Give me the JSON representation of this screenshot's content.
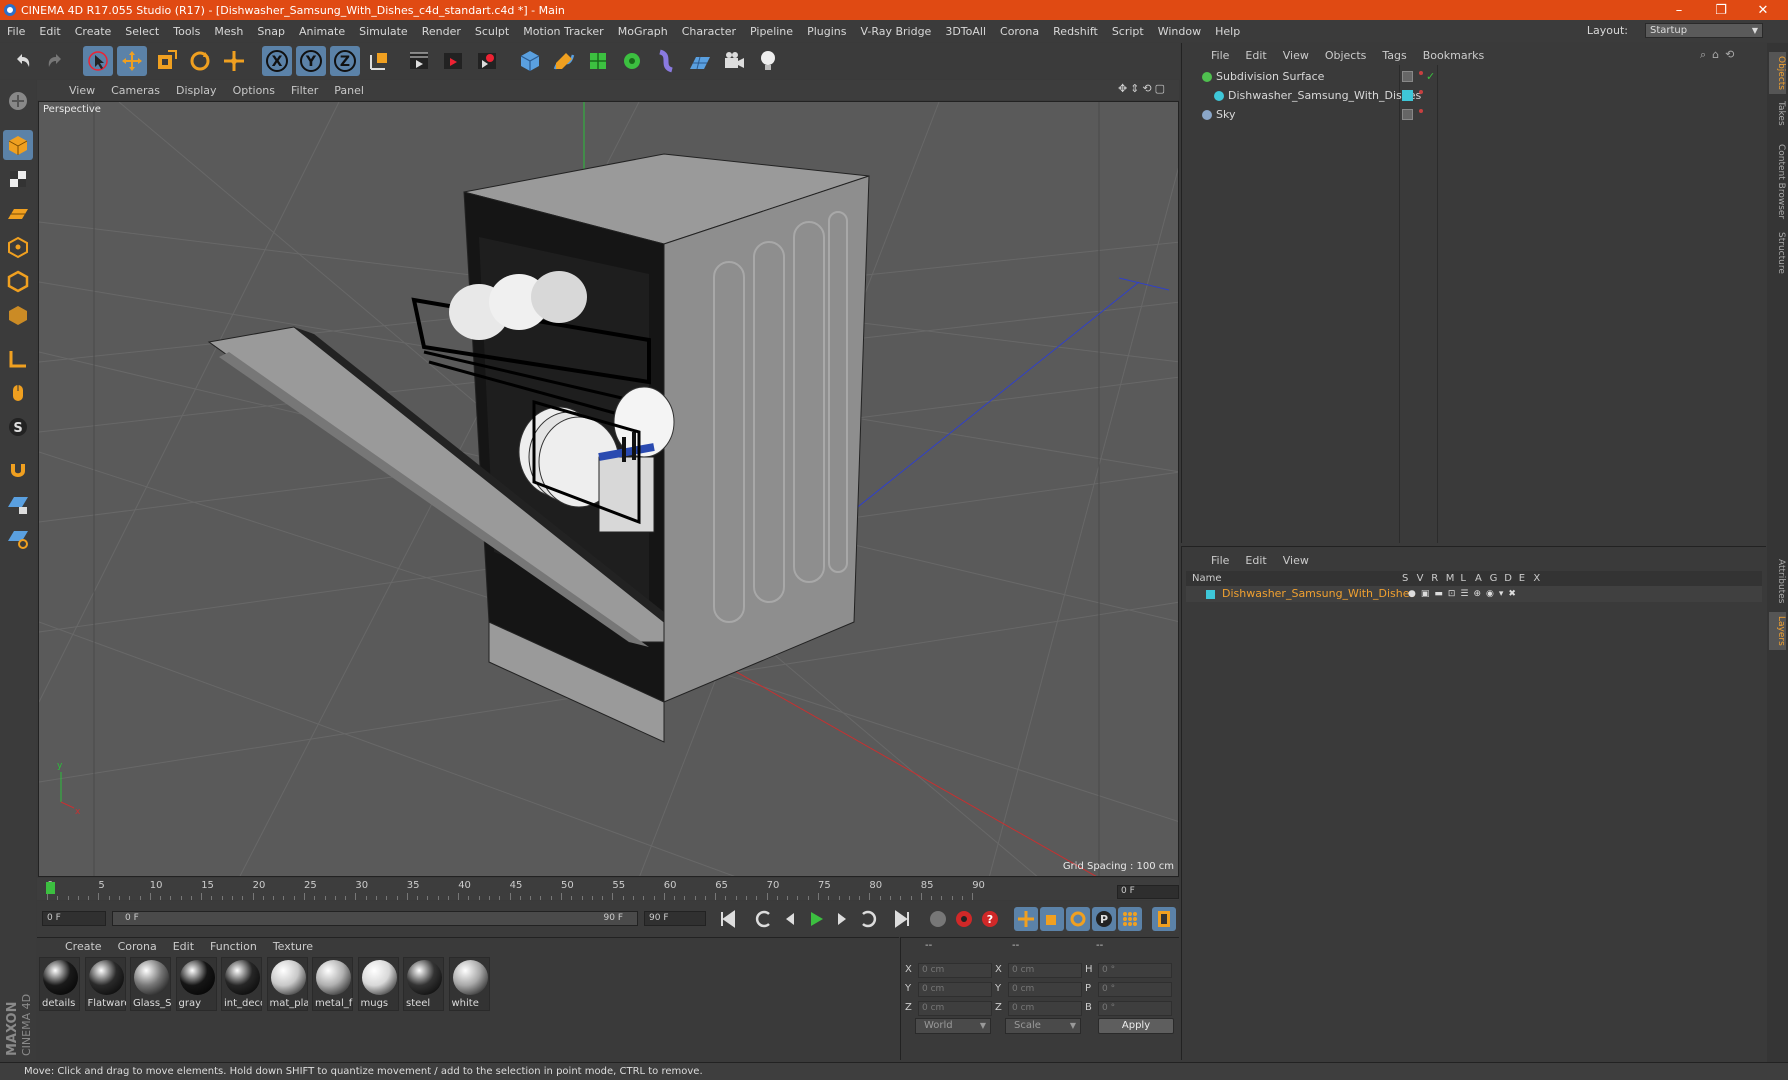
{
  "window": {
    "title": "CINEMA 4D R17.055 Studio (R17) - [Dishwasher_Samsung_With_Dishes_c4d_standart.c4d *] - Main",
    "controls": [
      "–",
      "❐",
      "✕"
    ]
  },
  "menubar": [
    "File",
    "Edit",
    "Create",
    "Select",
    "Tools",
    "Mesh",
    "Snap",
    "Animate",
    "Simulate",
    "Render",
    "Sculpt",
    "Motion Tracker",
    "MoGraph",
    "Character",
    "Pipeline",
    "Plugins",
    "V-Ray Bridge",
    "3DToAll",
    "Corona",
    "Redshift",
    "Script",
    "Window",
    "Help"
  ],
  "layout": {
    "label": "Layout:",
    "value": "Startup"
  },
  "toolbar": {
    "icons": [
      "undo-icon",
      "redo-icon",
      "select-icon",
      "move-icon",
      "scale-icon",
      "rotate-icon",
      "transform-icon",
      "x-axis-icon",
      "y-axis-icon",
      "z-axis-icon",
      "coordinate-icon",
      "render-view-icon",
      "render-picture-viewer-icon",
      "render-settings-icon",
      "cube-icon",
      "pen-icon",
      "subdivision-icon",
      "array-icon",
      "deformer-icon",
      "floor-icon",
      "camera-icon",
      "light-icon"
    ],
    "axis_labels": [
      "X",
      "Y",
      "Z"
    ]
  },
  "viewport": {
    "menu": [
      "View",
      "Cameras",
      "Display",
      "Options",
      "Filter",
      "Panel"
    ],
    "label": "Perspective",
    "grid_spacing": "Grid Spacing : 100 cm"
  },
  "timeline": {
    "ticks": [
      "0",
      "5",
      "10",
      "15",
      "20",
      "25",
      "30",
      "35",
      "40",
      "45",
      "50",
      "55",
      "60",
      "65",
      "70",
      "75",
      "80",
      "85",
      "90"
    ],
    "current_frame": "0 F",
    "start": "0 F",
    "range_start": "0 F",
    "range_end": "90 F",
    "end": "90 F"
  },
  "materials": {
    "menu": [
      "Create",
      "Corona",
      "Edit",
      "Function",
      "Texture"
    ],
    "items": [
      {
        "label": "details",
        "color": "#1a1a1a"
      },
      {
        "label": "Flatware",
        "color": "#2a2a2a"
      },
      {
        "label": "Glass_Si",
        "color": "#777777"
      },
      {
        "label": "gray",
        "color": "#151515"
      },
      {
        "label": "int_deco",
        "color": "#262626"
      },
      {
        "label": "mat_pla",
        "color": "#c8c8c8"
      },
      {
        "label": "metal_fr",
        "color": "#b0b0b0"
      },
      {
        "label": "mugs",
        "color": "#d8d8d8"
      },
      {
        "label": "steel",
        "color": "#333333"
      },
      {
        "label": "white",
        "color": "#a8a8a8"
      }
    ]
  },
  "coordinates": {
    "headers": [
      "--",
      "--",
      "--"
    ],
    "rows": [
      {
        "a": "X",
        "av": "0 cm",
        "b": "X",
        "bv": "0 cm",
        "c": "H",
        "cv": "0 °"
      },
      {
        "a": "Y",
        "av": "0 cm",
        "b": "Y",
        "bv": "0 cm",
        "c": "P",
        "cv": "0 °"
      },
      {
        "a": "Z",
        "av": "0 cm",
        "b": "Z",
        "bv": "0 cm",
        "c": "B",
        "cv": "0 °"
      }
    ],
    "space": "World",
    "mode": "Scale",
    "apply": "Apply"
  },
  "objects": {
    "menu": [
      "File",
      "Edit",
      "View",
      "Objects",
      "Tags",
      "Bookmarks"
    ],
    "items": [
      {
        "name": "Subdivision Surface",
        "indent": 0,
        "color": "#4fc04f"
      },
      {
        "name": "Dishwasher_Samsung_With_Dishes",
        "indent": 1,
        "color": "#3ec7d8"
      },
      {
        "name": "Sky",
        "indent": 0,
        "color": "#8aa6c8"
      }
    ]
  },
  "layers": {
    "menu": [
      "File",
      "Edit",
      "View"
    ],
    "columns": [
      "Name",
      "S",
      "V",
      "R",
      "M",
      "L",
      "A",
      "G",
      "D",
      "E",
      "X"
    ],
    "row": {
      "name": "Dishwasher_Samsung_With_Dishes",
      "color": "#f0a030",
      "swatch": "#3ec7d8"
    }
  },
  "right_tabs": [
    "Objects",
    "Takes",
    "Content Browser",
    "Structure",
    "Attributes",
    "Layers"
  ],
  "statusbar": "Move: Click and drag to move elements. Hold down SHIFT to quantize movement / add to the selection in point mode, CTRL to remove.",
  "brand": "MAXON CINEMA 4D"
}
